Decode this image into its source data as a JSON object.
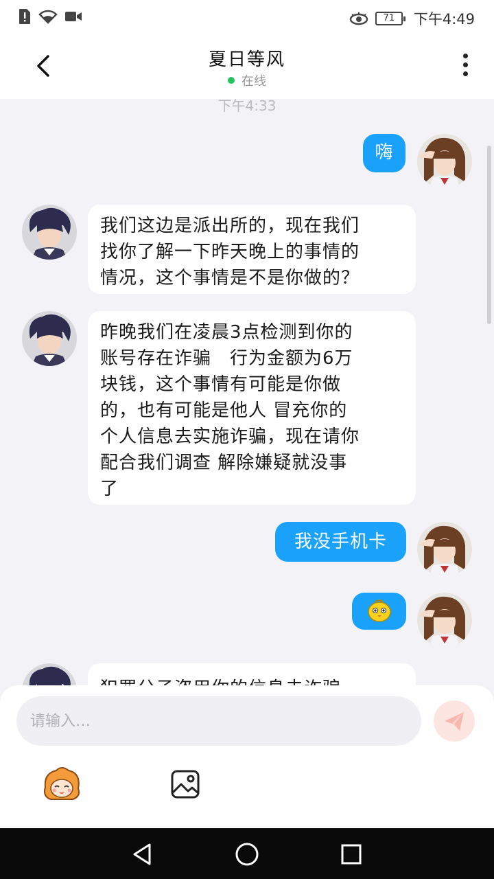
{
  "status_bar": {
    "battery": "71",
    "time": "下午4:49"
  },
  "header": {
    "title": "夏日等风",
    "status": "在线"
  },
  "chat": {
    "timestamp": "下午4:33",
    "messages": [
      {
        "side": "out",
        "text": "嗨"
      },
      {
        "side": "in",
        "lines": [
          "我们这边是派出所的，现在我们",
          "找你了解一下昨天晚上的事情的",
          "情况，这个事情是不是你做的？"
        ]
      },
      {
        "side": "in",
        "lines": [
          "昨晚我们在凌晨3点检测到你的",
          "账号存在诈骗　行为金额为6万",
          "块钱，这个事情有可能是你做",
          "的，也有可能是他人 冒充你的",
          "个人信息去实施诈骗，现在请你",
          "配合我们调查 解除嫌疑就没事",
          "了"
        ]
      },
      {
        "side": "out",
        "text": "我没手机卡"
      },
      {
        "side": "out",
        "text": "",
        "emoji": "yellow-chick-sticker"
      },
      {
        "side": "in",
        "lines": [
          "犯罪分子盗用你的信息去诈骗"
        ]
      }
    ]
  },
  "composer": {
    "placeholder": "请输入…"
  },
  "colors": {
    "accent": "#1aa2fb",
    "background": "#f3f3f7",
    "online": "#22c35e"
  }
}
